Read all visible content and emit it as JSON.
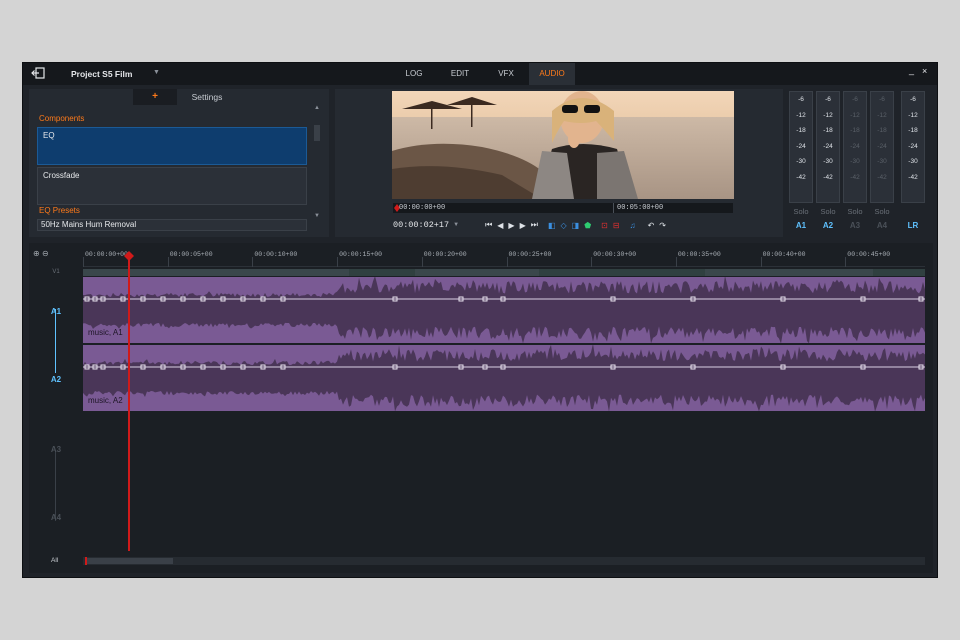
{
  "window": {
    "project_title": "Project S5 Film",
    "mode_tabs": [
      {
        "label": "LOG",
        "active": false
      },
      {
        "label": "EDIT",
        "active": false
      },
      {
        "label": "VFX",
        "active": false
      },
      {
        "label": "AUDIO",
        "active": true
      }
    ],
    "minimize_glyph": "_",
    "close_glyph": "×"
  },
  "effects_panel": {
    "tab_add": "+",
    "tab_settings": "Settings",
    "components_heading": "Components",
    "components": [
      "EQ",
      "Crossfade"
    ],
    "presets_heading": "EQ Presets",
    "preset_selected": "50Hz Mains Hum Removal"
  },
  "viewer": {
    "scrub_start_tc": "00:00:00+00",
    "scrub_end_tc": "00:05:00+00",
    "current_tc": "00:00:02+17"
  },
  "meters": {
    "scale": [
      "-6",
      "-12",
      "-18",
      "-24",
      "-30",
      "-42"
    ],
    "solo_label": "Solo",
    "channels": [
      {
        "label": "A1",
        "active": true
      },
      {
        "label": "A2",
        "active": true
      },
      {
        "label": "A3",
        "active": false
      },
      {
        "label": "A4",
        "active": false
      },
      {
        "label": "LR",
        "active": true
      }
    ]
  },
  "timeline": {
    "ruler": [
      "00:00:00+00",
      "00:00:05+00",
      "00:00:10+00",
      "00:00:15+00",
      "00:00:20+00",
      "00:00:25+00",
      "00:00:30+00",
      "00:00:35+00",
      "00:00:40+00",
      "00:00:45+00"
    ],
    "video_track_label": "V1",
    "tracks": [
      {
        "label": "A1",
        "clip": "music, A1",
        "active": true
      },
      {
        "label": "A2",
        "clip": "music, A2",
        "active": true
      },
      {
        "label": "A3",
        "clip": null,
        "active": false
      },
      {
        "label": "A4",
        "clip": null,
        "active": false
      }
    ],
    "all_label": "All",
    "clip_color": "#7a5a94",
    "accent_color": "#ff7a1a",
    "track_active_color": "#5fc2ff"
  }
}
